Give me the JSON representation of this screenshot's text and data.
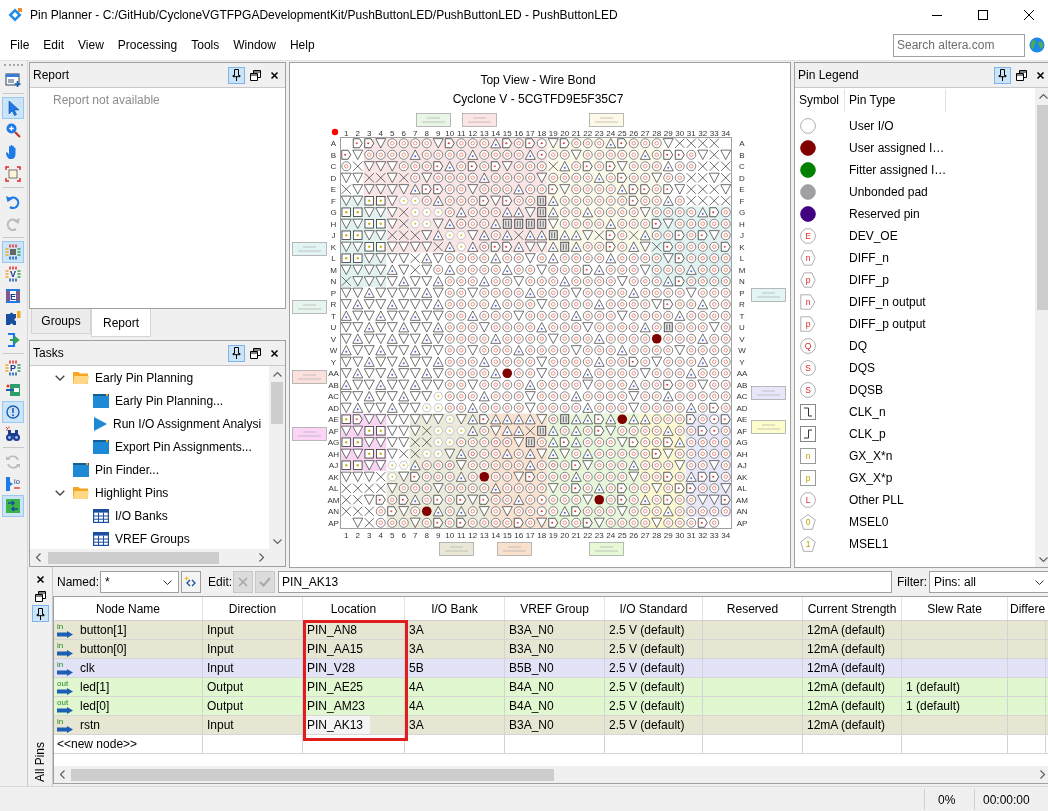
{
  "window": {
    "title": "Pin Planner - C:/GitHub/CycloneVGTFPGADevelopmentKit/PushButtonLED/PushButtonLED - PushButtonLED"
  },
  "menu": [
    "File",
    "Edit",
    "View",
    "Processing",
    "Tools",
    "Window",
    "Help"
  ],
  "search": {
    "placeholder": "Search altera.com"
  },
  "toolbar": {
    "groups": [
      {
        "tools": [
          {
            "kind": "window",
            "selected": false,
            "disabled": false
          }
        ]
      },
      {
        "tools": [
          {
            "kind": "pointer",
            "selected": true,
            "disabled": false
          },
          {
            "kind": "zoom",
            "selected": false,
            "disabled": false
          },
          {
            "kind": "hand",
            "selected": false,
            "disabled": false
          },
          {
            "kind": "fit",
            "selected": false,
            "disabled": false
          }
        ]
      },
      {
        "tools": [
          {
            "kind": "undo",
            "selected": false,
            "disabled": false
          },
          {
            "kind": "redo",
            "selected": false,
            "disabled": true
          }
        ]
      },
      {
        "tools": [
          {
            "kind": "chip",
            "selected": true,
            "disabled": false
          },
          {
            "kind": "chip-letter",
            "glyph": "V",
            "selected": false,
            "disabled": false
          },
          {
            "kind": "letter-box",
            "glyph": "E",
            "selected": false,
            "disabled": false
          },
          {
            "kind": "puzzle",
            "selected": false,
            "disabled": false
          },
          {
            "kind": "bracket-arrow",
            "selected": false,
            "disabled": false
          }
        ]
      },
      {
        "tools": [
          {
            "kind": "chip-letter",
            "glyph": "P",
            "selected": false,
            "disabled": false
          },
          {
            "kind": "board",
            "selected": false,
            "disabled": false
          },
          {
            "kind": "info",
            "selected": true,
            "disabled": false
          },
          {
            "kind": "binoculars",
            "selected": false,
            "disabled": false
          }
        ]
      },
      {
        "tools": [
          {
            "kind": "refresh",
            "selected": false,
            "disabled": true
          },
          {
            "kind": "io-port",
            "glyph": "io",
            "selected": false,
            "disabled": false
          },
          {
            "kind": "grid-arrows",
            "selected": true,
            "disabled": false
          }
        ]
      }
    ]
  },
  "report": {
    "title": "Report",
    "pinned": true,
    "message": "Report not available"
  },
  "left_tabs": [
    {
      "label": "Groups",
      "selected": false
    },
    {
      "label": "Report",
      "selected": true
    }
  ],
  "tasks": {
    "title": "Tasks",
    "pinned": true,
    "items": [
      {
        "kind": "folder",
        "label": "Early Pin Planning",
        "expanded": true,
        "children": [
          {
            "kind": "window",
            "label": "Early Pin Planning..."
          },
          {
            "kind": "run",
            "label": "Run I/O Assignment Analysi"
          },
          {
            "kind": "window",
            "label": "Export Pin Assignments..."
          }
        ]
      },
      {
        "kind": "window",
        "label": "Pin Finder..."
      },
      {
        "kind": "folder",
        "label": "Highlight Pins",
        "expanded": true,
        "children": [
          {
            "kind": "table",
            "label": "I/O Banks"
          },
          {
            "kind": "table",
            "label": "VREF Groups"
          }
        ]
      }
    ]
  },
  "pin_view": {
    "title": "Top View - Wire Bond",
    "device": "Cyclone V - 5CGTFD9E5F35C7",
    "top_column_labels": [
      "1",
      "2",
      "3",
      "4",
      "5",
      "6",
      "7",
      "8",
      "9",
      "10",
      "11",
      "12",
      "13",
      "14",
      "15",
      "16",
      "17",
      "18",
      "19",
      "20",
      "21",
      "22",
      "23",
      "24",
      "25",
      "26",
      "27",
      "28",
      "29",
      "30",
      "31",
      "32",
      "33",
      "34"
    ],
    "bottom_column_labels": [
      "1",
      "2",
      "3",
      "4",
      "5",
      "6",
      "7",
      "8",
      "9",
      "10",
      "11",
      "12",
      "13",
      "14",
      "15",
      "16",
      "17",
      "18",
      "19",
      "20",
      "21",
      "22",
      "23",
      "24",
      "25",
      "26",
      "27",
      "28",
      "29",
      "30",
      "31",
      "32",
      "33",
      "34"
    ],
    "left_row_labels": [
      "A",
      "B",
      "C",
      "D",
      "E",
      "F",
      "G",
      "H",
      "J",
      "K",
      "L",
      "M",
      "N",
      "P",
      "R",
      "T",
      "U",
      "V",
      "W",
      "Y",
      "AA",
      "AB",
      "AC",
      "AD",
      "AE",
      "AF",
      "AG",
      "AH",
      "AJ",
      "AK",
      "AL",
      "AM",
      "AN",
      "AP"
    ],
    "right_row_labels": [
      "A",
      "B",
      "C",
      "D",
      "E",
      "F",
      "G",
      "H",
      "J",
      "K",
      "L",
      "M",
      "N",
      "P",
      "R",
      "T",
      "U",
      "V",
      "W",
      "Y",
      "AA",
      "AB",
      "AC",
      "AD",
      "AE",
      "AF",
      "AG",
      "AH",
      "AJ",
      "AK",
      "AL",
      "AM",
      "AN",
      "AP"
    ],
    "bank_regions": [
      {
        "color": "#f8e6e6"
      },
      {
        "color": "#fbf9ea"
      },
      {
        "color": "#e2f2f1"
      },
      {
        "color": "#f8d6f3"
      },
      {
        "color": "#eceadb"
      },
      {
        "color": "#f8e2d2"
      },
      {
        "color": "#e8f7db"
      },
      {
        "color": "#fbf8d2"
      },
      {
        "color": "#e8e7f8"
      }
    ],
    "bank_tags": {
      "top": [
        {
          "color": "#e9f6e6"
        },
        {
          "color": "#fbe5e5"
        },
        {
          "color": "#fcf9e6"
        }
      ],
      "left": [
        {
          "color": "#e2f5f4"
        },
        {
          "color": "#e6f6ee"
        },
        {
          "color": "#fbe0dc"
        },
        {
          "color": "#fbd4f6"
        }
      ],
      "right": [
        {
          "color": "#e2f5f4"
        },
        {
          "color": "#e8e6fa"
        },
        {
          "color": "#fdfccc"
        }
      ],
      "bottom": [
        {
          "color": "#e9e8d6"
        },
        {
          "color": "#f9e0cc"
        },
        {
          "color": "#e6f8d6"
        }
      ]
    }
  },
  "legend": {
    "title": "Pin Legend",
    "pinned": true,
    "columns": [
      "Symbol",
      "Pin Type"
    ],
    "items": [
      {
        "kind": "circle",
        "label": "User I/O"
      },
      {
        "kind": "circle",
        "color": "#800000",
        "label": "User assigned I…"
      },
      {
        "kind": "circle",
        "color": "#008000",
        "label": "Fitter assigned I…"
      },
      {
        "kind": "circle",
        "color": "#a0a0a4",
        "label": "Unbonded pad"
      },
      {
        "kind": "circle",
        "color": "#400080",
        "label": "Reserved pin"
      },
      {
        "kind": "circle",
        "glyph": "E",
        "label": "DEV_OE"
      },
      {
        "kind": "hexagon",
        "glyph": "n",
        "label": "DIFF_n"
      },
      {
        "kind": "hexagon",
        "glyph": "p",
        "label": "DIFF_p"
      },
      {
        "kind": "tag",
        "glyph": "n",
        "label": "DIFF_n output"
      },
      {
        "kind": "tag",
        "glyph": "p",
        "label": "DIFF_p output"
      },
      {
        "kind": "circle",
        "glyph": "Q",
        "label": "DQ"
      },
      {
        "kind": "circle",
        "glyph": "S",
        "label": "DQS"
      },
      {
        "kind": "circle",
        "glyph": "S",
        "label": "DQSB"
      },
      {
        "kind": "falling-edge",
        "label": "CLK_n"
      },
      {
        "kind": "rising-edge",
        "label": "CLK_p"
      },
      {
        "kind": "square",
        "glyph": "n",
        "label": "GX_X*n"
      },
      {
        "kind": "square",
        "glyph": "p",
        "label": "GX_X*p"
      },
      {
        "kind": "circle",
        "glyph": "L",
        "label": "Other PLL"
      },
      {
        "kind": "pentagon",
        "glyph": "0",
        "label": "MSEL0"
      },
      {
        "kind": "pentagon",
        "glyph": "1",
        "label": "MSEL1"
      }
    ]
  },
  "all_pins": {
    "tab_label": "All Pins",
    "pinned": true,
    "named": {
      "label": "Named:",
      "value": "*"
    },
    "edit": {
      "label": "Edit:",
      "value": "PIN_AK13",
      "actions": [
        {
          "kind": "cancel",
          "disabled": true
        },
        {
          "kind": "accept",
          "disabled": true
        }
      ]
    },
    "filter": {
      "label": "Filter:",
      "value": "Pins: all"
    },
    "table": {
      "columns": [
        {
          "label": "Node Name",
          "highlighted": false
        },
        {
          "label": "Direction",
          "highlighted": false
        },
        {
          "label": "Location",
          "highlighted": true
        },
        {
          "label": "I/O Bank",
          "highlighted": false
        },
        {
          "label": "VREF Group",
          "highlighted": false
        },
        {
          "label": "I/O Standard",
          "highlighted": false
        },
        {
          "label": "Reserved",
          "highlighted": false
        },
        {
          "label": "Current Strength",
          "highlighted": false
        },
        {
          "label": "Slew Rate",
          "highlighted": false
        },
        {
          "label": "Differe",
          "highlighted": false
        }
      ],
      "rows": [
        {
          "port": "in",
          "name": "button[1]",
          "direction": "Input",
          "location": "PIN_AN8",
          "io_bank": "3A",
          "vref_group": "B3A_N0",
          "io_standard": "2.5 V (default)",
          "current_strength": "12mA (default)",
          "color": "#e6e6d2",
          "selected": false
        },
        {
          "port": "in",
          "name": "button[0]",
          "direction": "Input",
          "location": "PIN_AA15",
          "io_bank": "3A",
          "vref_group": "B3A_N0",
          "io_standard": "2.5 V (default)",
          "current_strength": "12mA (default)",
          "color": "#e6e6d2",
          "selected": false
        },
        {
          "port": "in",
          "name": "clk",
          "direction": "Input",
          "location": "PIN_V28",
          "io_bank": "5B",
          "vref_group": "B5B_N0",
          "io_standard": "2.5 V (default)",
          "current_strength": "12mA (default)",
          "color": "#e3e3f8",
          "selected": false
        },
        {
          "port": "out",
          "name": "led[1]",
          "direction": "Output",
          "location": "PIN_AE25",
          "io_bank": "4A",
          "vref_group": "B4A_N0",
          "io_standard": "2.5 V (default)",
          "current_strength": "12mA (default)",
          "slew_rate": "1 (default)",
          "color": "#e1f7d0",
          "selected": false
        },
        {
          "port": "out",
          "name": "led[0]",
          "direction": "Output",
          "location": "PIN_AM23",
          "io_bank": "4A",
          "vref_group": "B4A_N0",
          "io_standard": "2.5 V (default)",
          "current_strength": "12mA (default)",
          "slew_rate": "1 (default)",
          "color": "#e1f7d0",
          "selected": false
        },
        {
          "port": "in",
          "name": "rstn",
          "direction": "Input",
          "location": "PIN_AK13",
          "io_bank": "3A",
          "vref_group": "B3A_N0",
          "io_standard": "2.5 V (default)",
          "current_strength": "12mA (default)",
          "color": "#e6e6d2",
          "selected": true
        }
      ],
      "new_row": "<<new node>>"
    }
  },
  "status_bar": {
    "progress": "0%",
    "elapsed": "00:00:00"
  }
}
